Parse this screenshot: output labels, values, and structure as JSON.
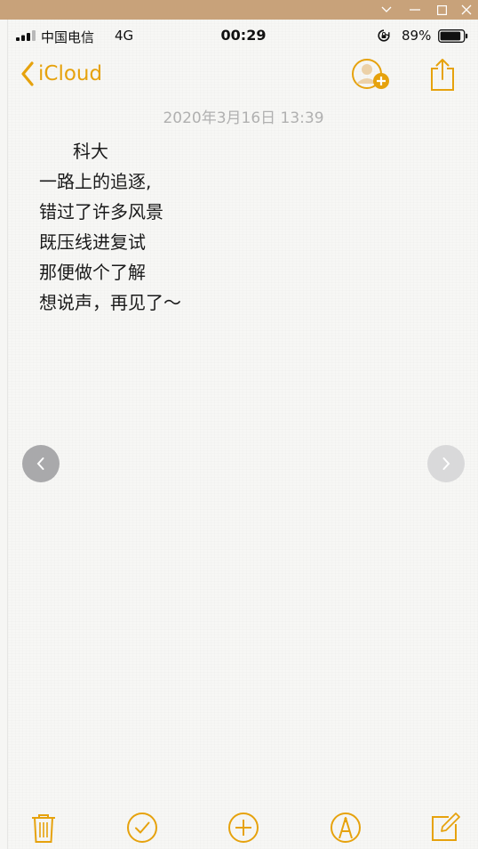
{
  "window": {
    "icons": [
      "chevron-down-icon",
      "minimize-icon",
      "maximize-icon",
      "close-icon"
    ]
  },
  "status_bar": {
    "carrier": "中国电信",
    "network": "4G",
    "time": "00:29",
    "battery_percent": "89%",
    "battery_level": 0.89
  },
  "nav": {
    "back_label": "iCloud",
    "accent_color": "#e6a20d"
  },
  "note": {
    "date": "2020年3月16日 13:39",
    "lines": [
      "科大",
      "一路上的追逐,",
      "错过了许多风景",
      "既压线进复试",
      "那便做个了解",
      "想说声，再见了～"
    ]
  },
  "toolbar": {
    "icons": [
      "trash-icon",
      "checklist-icon",
      "add-icon",
      "markup-icon",
      "compose-icon"
    ]
  }
}
